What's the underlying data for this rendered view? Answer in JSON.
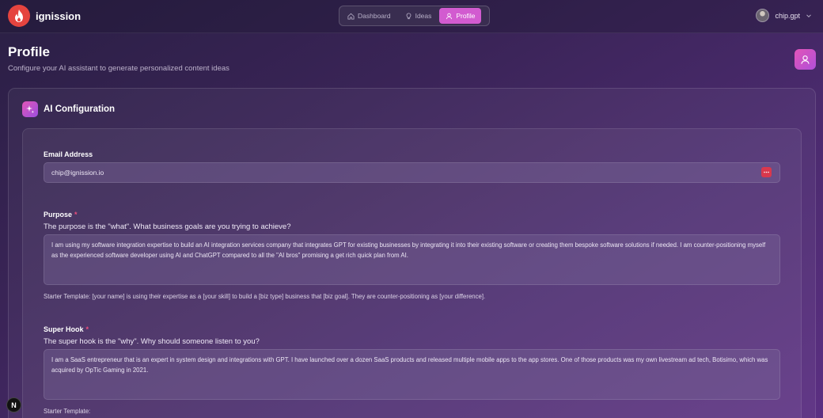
{
  "app": {
    "name": "ignission"
  },
  "nav": {
    "items": [
      {
        "label": "Dashboard",
        "icon": "home-icon",
        "active": false
      },
      {
        "label": "Ideas",
        "icon": "lightbulb-icon",
        "active": false
      },
      {
        "label": "Profile",
        "icon": "user-icon",
        "active": true
      }
    ]
  },
  "user": {
    "name": "chip.gpt"
  },
  "header": {
    "title": "Profile",
    "subtitle": "Configure your AI assistant to generate personalized content ideas"
  },
  "card": {
    "title": "AI Configuration"
  },
  "form": {
    "email": {
      "label": "Email Address",
      "value": "chip@ignission.io"
    },
    "purpose": {
      "label": "Purpose",
      "required_mark": "*",
      "question": "The purpose is the \"what\". What business goals are you trying to achieve?",
      "value": "I am using my software integration expertise to build an AI integration services company that integrates GPT for existing businesses by integrating it into their existing software or creating them bespoke software solutions if needed. I am counter-positioning myself as the experienced software developer using AI and ChatGPT compared to all the \"AI bros\" promising a get rich quick plan from AI.",
      "hint": "Starter Template: [your name] is using their expertise as a [your skill] to build a [biz type] business that [biz goal]. They are counter-positioning as [your difference]."
    },
    "super_hook": {
      "label": "Super Hook",
      "required_mark": "*",
      "question": "The super hook is the \"why\". Why should someone listen to you?",
      "value": "I am a SaaS entrepreneur that is an expert in system design and integrations with GPT. I have launched over a dozen SaaS products and released multiple mobile apps to the app stores. One of those products was my own livestream ad tech, Botisimo, which was acquired by OpTic Gaming in 2021.",
      "hint": "Starter Template:"
    }
  },
  "dev_badge": {
    "label": "N"
  },
  "colors": {
    "accent": "#d25bd0",
    "logo": "#e5443f",
    "required": "#ef4f7c"
  }
}
